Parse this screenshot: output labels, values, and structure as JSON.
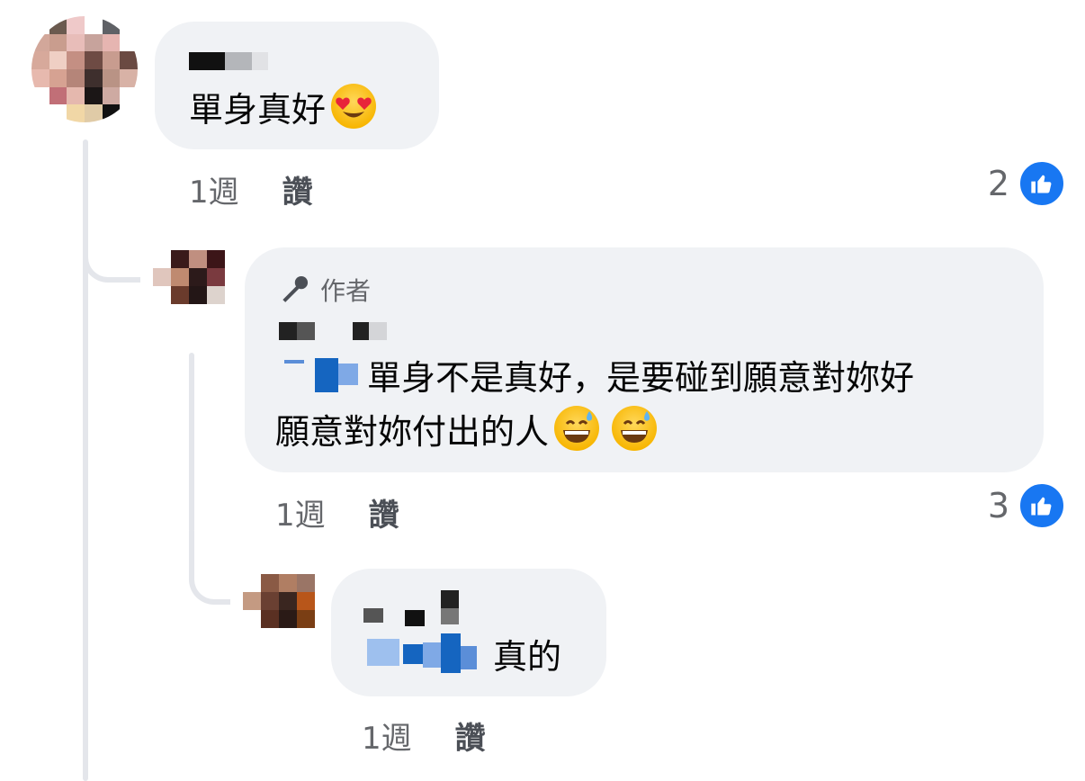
{
  "comments": [
    {
      "text": "單身真好",
      "emoji": [
        "heart-eyes"
      ],
      "time": "1週",
      "like_label": "讚",
      "reaction_count": "2"
    },
    {
      "author_badge": "作者",
      "text_line1": "單身不是真好，是要碰到願意對妳好",
      "text_line2": "願意對妳付出的人",
      "emoji": [
        "grinning-sweat",
        "grinning-sweat"
      ],
      "time": "1週",
      "like_label": "讚",
      "reaction_count": "3"
    },
    {
      "text": "真的",
      "time": "1週",
      "like_label": "讚"
    }
  ],
  "colors": {
    "bubble": "#f0f2f5",
    "meta_text": "#65676b",
    "like_blue": "#1877f2",
    "thread_line": "#e4e6eb"
  },
  "icons": [
    "thumbs-up-icon",
    "microphone-icon",
    "heart-eyes-emoji",
    "grinning-sweat-emoji"
  ]
}
